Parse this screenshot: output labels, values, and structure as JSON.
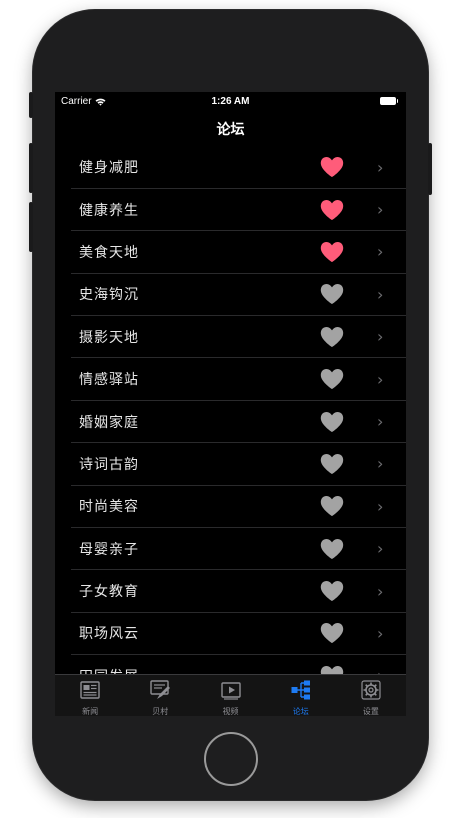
{
  "status_bar": {
    "carrier": "Carrier",
    "time": "1:26 AM"
  },
  "nav": {
    "title": "论坛"
  },
  "accent_color": "#1e7bf2",
  "favorite_color": "#ff5c7a",
  "unfavorite_color": "#a3a3a3",
  "forums": [
    {
      "name": "健身减肥",
      "favorited": true
    },
    {
      "name": "健康养生",
      "favorited": true
    },
    {
      "name": "美食天地",
      "favorited": true
    },
    {
      "name": "史海钩沉",
      "favorited": false
    },
    {
      "name": "摄影天地",
      "favorited": false
    },
    {
      "name": "情感驿站",
      "favorited": false
    },
    {
      "name": "婚姻家庭",
      "favorited": false
    },
    {
      "name": "诗词古韵",
      "favorited": false
    },
    {
      "name": "时尚美容",
      "favorited": false
    },
    {
      "name": "母婴亲子",
      "favorited": false
    },
    {
      "name": "子女教育",
      "favorited": false
    },
    {
      "name": "职场风云",
      "favorited": false
    },
    {
      "name": "田园发展",
      "favorited": false
    }
  ],
  "tabs": [
    {
      "label": "新闻",
      "icon": "newspaper-icon",
      "active": false
    },
    {
      "label": "贝村",
      "icon": "edit-note-icon",
      "active": false
    },
    {
      "label": "视频",
      "icon": "video-play-icon",
      "active": false
    },
    {
      "label": "论坛",
      "icon": "hierarchy-icon",
      "active": true
    },
    {
      "label": "设置",
      "icon": "gear-icon",
      "active": false
    }
  ]
}
